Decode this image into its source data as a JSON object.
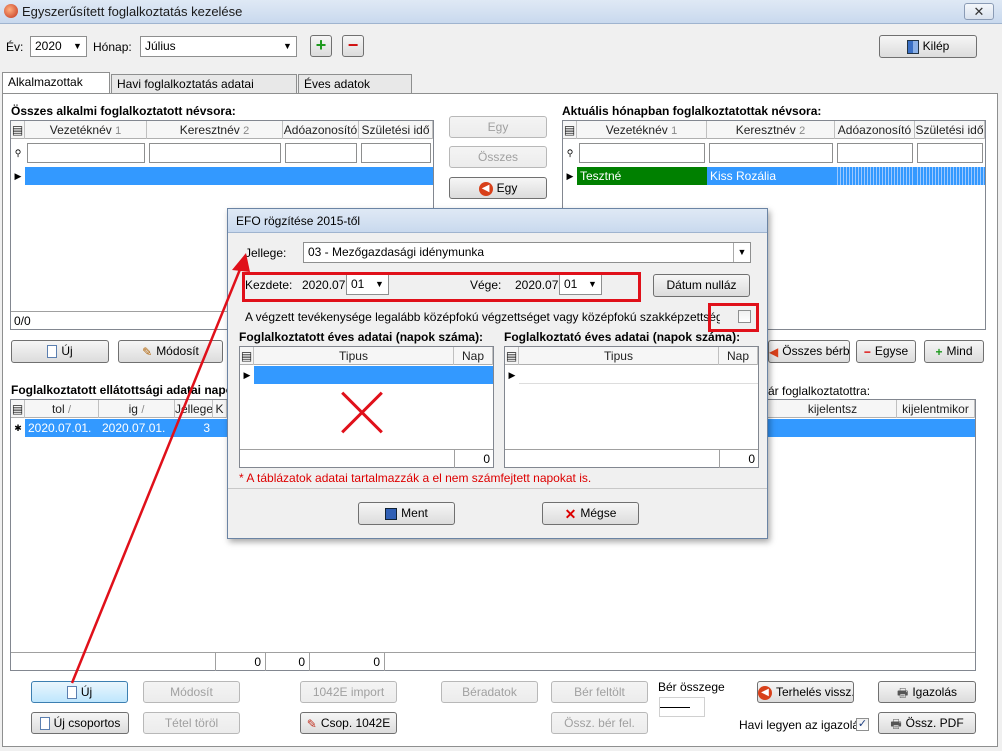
{
  "window": {
    "title": "Egyszerűsített foglalkoztatás kezelése",
    "close": "✕"
  },
  "toolbar": {
    "year_label": "Év:",
    "year_value": "2020",
    "month_label": "Hónap:",
    "month_value": "Július",
    "add_glyph": "+",
    "remove_glyph": "−",
    "exit_label": "Kilép"
  },
  "tabs": [
    "Alkalmazottak adatai",
    "Havi foglalkoztatás adatai összesítve",
    "Éves adatok egyben"
  ],
  "left_list": {
    "title": "Összes alkalmi foglalkoztatott névsora:",
    "columns": [
      "Vezetéknév",
      "Keresztnév",
      "Adóazonosító",
      "Születési idő"
    ],
    "sort_nums": [
      "1",
      "2"
    ],
    "count": "0/0"
  },
  "middle_buttons": {
    "one": "Egy",
    "all": "Összes",
    "one_back": "Egy"
  },
  "right_list": {
    "title": "Aktuális hónapban foglalkoztatottak névsora:",
    "columns": [
      "Vezetéknév",
      "Keresztnév",
      "Adóazonosító",
      "Születési idő"
    ],
    "sort_nums": [
      "1",
      "2"
    ],
    "row": {
      "last": "Tesztné",
      "first": "Kiss Rozália"
    }
  },
  "left_actions": {
    "new": "Új",
    "edit": "Módosít"
  },
  "right_actions": {
    "all_wage": "Összes bérbe",
    "one": "Egyse",
    "all": "Mind"
  },
  "bottom_grid": {
    "title": "Foglalkoztatott ellátottsági adatai napo",
    "right_title": "ár foglalkoztatottra:",
    "columns": [
      "tol",
      "ig",
      "Jellege",
      "K"
    ],
    "right_columns": [
      "kijelentsz",
      "kijelentmikor"
    ],
    "sort_nums": [
      "/",
      "/"
    ],
    "row": {
      "tol": "2020.07.01.",
      "ig": "2020.07.01.",
      "jellege": "3"
    },
    "totals": [
      "0",
      "0",
      "0"
    ]
  },
  "bottom_buttons": {
    "new": "Új",
    "edit": "Módosít",
    "import": "1042E import",
    "wage_data": "Béradatok",
    "wage_upload": "Bér feltölt",
    "wage_sum_label": "Bér összege",
    "wage_sum_value": "",
    "load_back": "Terhelés vissz.",
    "cert": "Igazolás",
    "new_group": "Új csoportos",
    "delete_item": "Tétel töröl",
    "group_1042": "Csop. 1042E",
    "sum_wage_upload": "Össz. bér fel.",
    "monthly_cert_label": "Havi legyen az igazolás",
    "sum_pdf": "Össz. PDF"
  },
  "dialog": {
    "title": "EFO rögzítése 2015-től",
    "type_label": "Jellege:",
    "type_value": "03 - Mezőgazdasági idénymunka",
    "start_label": "Kezdete:",
    "start_prefix": "2020.07.",
    "start_day": "01",
    "end_label": "Vége:",
    "end_prefix": "2020.07.",
    "end_day": "01",
    "reset_date": "Dátum nulláz",
    "checkbox_label": "A végzett tevékenysége legalább középfokú végzettséget vagy középfokú szakképzettséget igényel",
    "employee_title": "Foglalkoztatott éves adatai (napok száma):",
    "employer_title": "Foglalkoztató éves adatai (napok száma):",
    "col_type": "Tipus",
    "col_day": "Nap",
    "employee_total": "0",
    "employer_total": "0",
    "note": "* A táblázatok adatai tartalmazzák a el nem számfejtett napokat is.",
    "save": "Ment",
    "cancel": "Mégse"
  },
  "colors": {
    "selection": "#3399ff",
    "green_row": "#008000",
    "annotation_red": "#e0101a"
  }
}
